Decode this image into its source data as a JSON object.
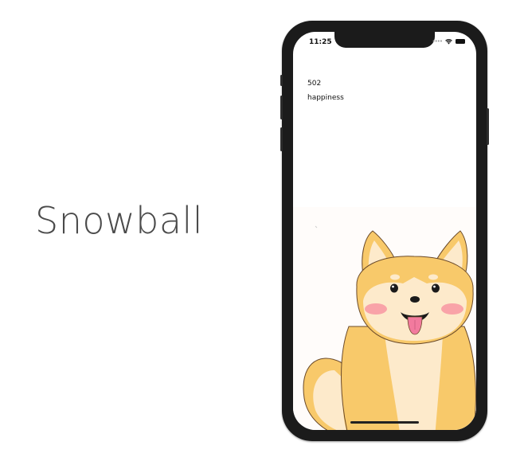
{
  "app": {
    "title": "Snowball"
  },
  "status_bar": {
    "time": "11:25",
    "signal_icon": "cellular-dots-icon",
    "wifi_icon": "wifi-icon",
    "battery_icon": "battery-icon"
  },
  "pet": {
    "score": "502",
    "stat_label": "happiness",
    "image_icon": "shiba-inu-dog-illustration"
  },
  "colors": {
    "fur": "#f8c96a",
    "fur_light": "#fdeacb",
    "blush": "#f9a3a8",
    "tongue": "#f27a9e",
    "phone_frame": "#1b1b1b"
  }
}
